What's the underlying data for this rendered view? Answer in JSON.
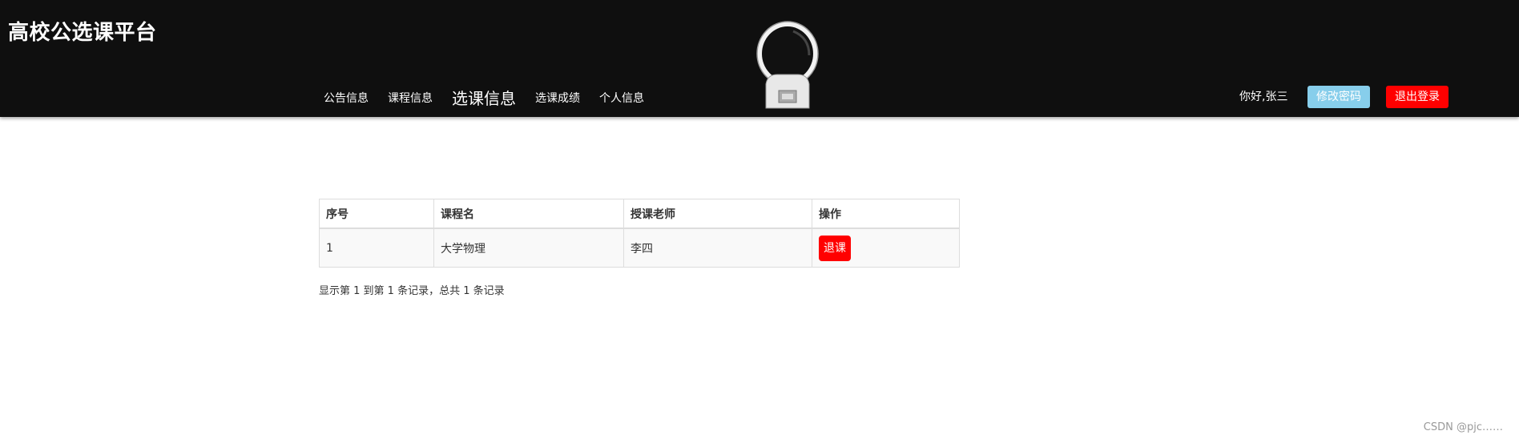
{
  "header": {
    "site_title": "高校公选课平台",
    "nav": [
      {
        "label": "公告信息",
        "active": false
      },
      {
        "label": "课程信息",
        "active": false
      },
      {
        "label": "选课信息",
        "active": true
      },
      {
        "label": "选课成绩",
        "active": false
      },
      {
        "label": "个人信息",
        "active": false
      }
    ],
    "greeting": "你好,张三",
    "change_password_label": "修改密码",
    "logout_label": "退出登录",
    "colors": {
      "background": "#0f0f0f",
      "change_password": "#87ceeb",
      "logout": "#ff0000"
    }
  },
  "table": {
    "columns": [
      "序号",
      "课程名",
      "授课老师",
      "操作"
    ],
    "rows": [
      {
        "index": "1",
        "course": "大学物理",
        "teacher": "李四",
        "action_label": "退课"
      }
    ]
  },
  "pagination": {
    "summary": "显示第 1 到第 1 条记录，总共 1 条记录"
  },
  "watermark": "CSDN @pjc……"
}
